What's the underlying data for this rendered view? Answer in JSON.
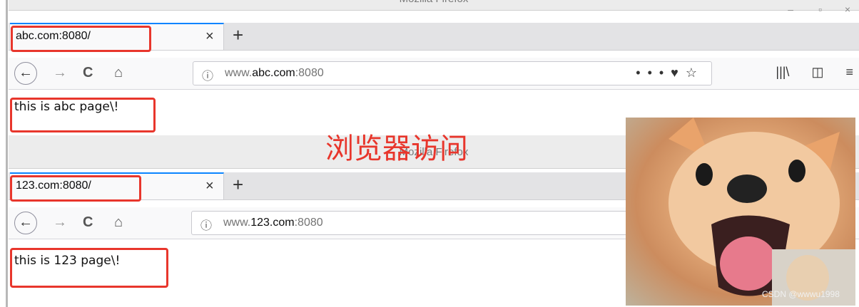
{
  "window1": {
    "title": "Mozilla Firefox",
    "tab_label": "abc.com:8080/",
    "tab_close": "×",
    "new_tab": "+",
    "url_prefix": "www.",
    "url_host": "abc.com",
    "url_port": ":8080",
    "page_text": "this is abc page\\!"
  },
  "window2": {
    "title": "Mozilla Firefox",
    "tab_label": "123.com:8080/",
    "tab_close": "×",
    "new_tab": "+",
    "url_prefix": "www.",
    "url_host": "123.com",
    "url_port": ":8080",
    "page_text": "this is 123 page\\!"
  },
  "annotation": "浏览器访问",
  "watermark": "CSDN @wwwu1998",
  "icons": {
    "back": "back-arrow-icon",
    "forward": "forward-arrow-icon",
    "reload": "reload-icon",
    "home": "home-icon",
    "info": "info-icon",
    "more": "page-actions-icon",
    "pocket": "pocket-icon",
    "bookmark": "bookmark-star-icon",
    "library": "library-icon",
    "sidebar": "sidebar-icon",
    "menu": "hamburger-menu-icon"
  },
  "colors": {
    "highlight": "#e8362c",
    "tab_accent": "#0a84ff"
  }
}
